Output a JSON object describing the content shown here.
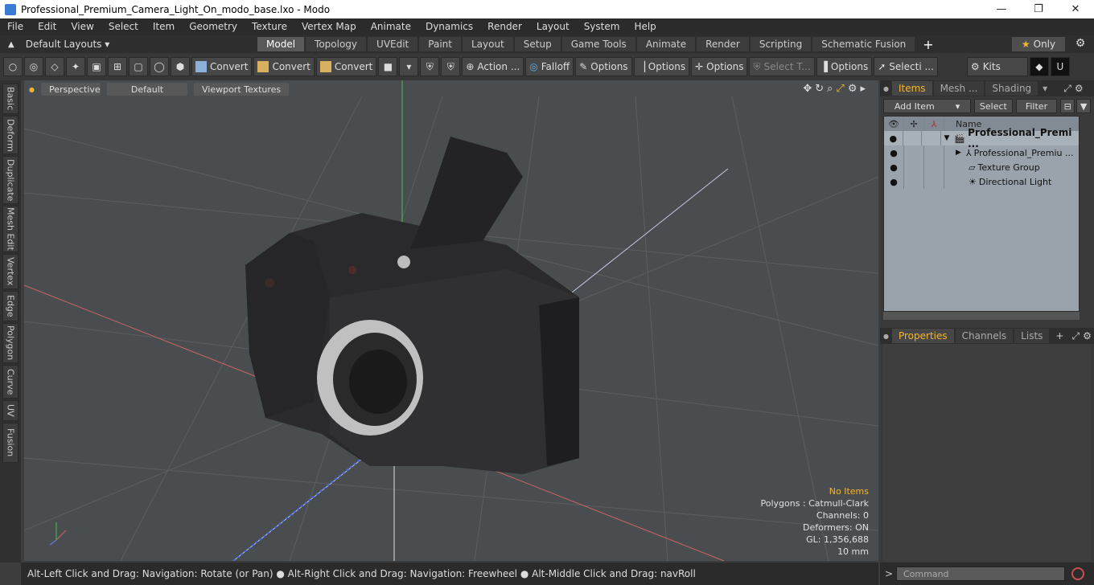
{
  "window": {
    "title": "Professional_Premium_Camera_Light_On_modo_base.lxo - Modo",
    "minimize": "—",
    "maximize": "❐",
    "close": "✕"
  },
  "menu": [
    "File",
    "Edit",
    "View",
    "Select",
    "Item",
    "Geometry",
    "Texture",
    "Vertex Map",
    "Animate",
    "Dynamics",
    "Render",
    "Layout",
    "System",
    "Help"
  ],
  "layouts": {
    "selector": "Default Layouts ▾"
  },
  "tabs": [
    {
      "label": "Model",
      "active": true
    },
    {
      "label": "Topology"
    },
    {
      "label": "UVEdit"
    },
    {
      "label": "Paint"
    },
    {
      "label": "Layout"
    },
    {
      "label": "Setup"
    },
    {
      "label": "Game Tools"
    },
    {
      "label": "Animate"
    },
    {
      "label": "Render"
    },
    {
      "label": "Scripting"
    },
    {
      "label": "Schematic Fusion"
    }
  ],
  "only_label": "Only",
  "toolbar": {
    "convert1": "Convert",
    "convert2": "Convert",
    "convert3": "Convert",
    "action": "Action ...",
    "falloff": "Falloff",
    "options1": "Options",
    "options2": "Options",
    "options3": "Options",
    "select_t": "Select T...",
    "options4": "Options",
    "selecti": "Selecti ...",
    "kits": "Kits"
  },
  "sidebar_tabs": [
    "Basic",
    "Deform",
    "Duplicate",
    "Mesh Edit",
    "Vertex",
    "Edge",
    "Polygon",
    "Curve",
    "UV",
    "Fusion"
  ],
  "viewport": {
    "view": "Perspective",
    "style": "Default",
    "textures": "Viewport Textures",
    "info": {
      "no_items": "No Items",
      "polygons": "Polygons : Catmull-Clark",
      "channels": "Channels: 0",
      "deformers": "Deformers: ON",
      "gl": "GL: 1,356,688",
      "scale": "10 mm"
    }
  },
  "status": "Alt-Left Click and Drag: Navigation: Rotate (or Pan) ● Alt-Right Click and Drag: Navigation: Freewheel ● Alt-Middle Click and Drag: navRoll",
  "items_panel": {
    "tabs": [
      "Items",
      "Mesh ...",
      "Shading"
    ],
    "add_item": "Add Item",
    "select": "Select",
    "filter": "Filter",
    "name_header": "Name",
    "rows": [
      {
        "label": "Professional_Premi ...",
        "bold": true
      },
      {
        "label": "Professional_Premiu ..."
      },
      {
        "label": "Texture Group"
      },
      {
        "label": "Directional Light"
      }
    ]
  },
  "props_panel": {
    "tabs": [
      "Properties",
      "Channels",
      "Lists"
    ]
  },
  "command": {
    "placeholder": "Command"
  }
}
